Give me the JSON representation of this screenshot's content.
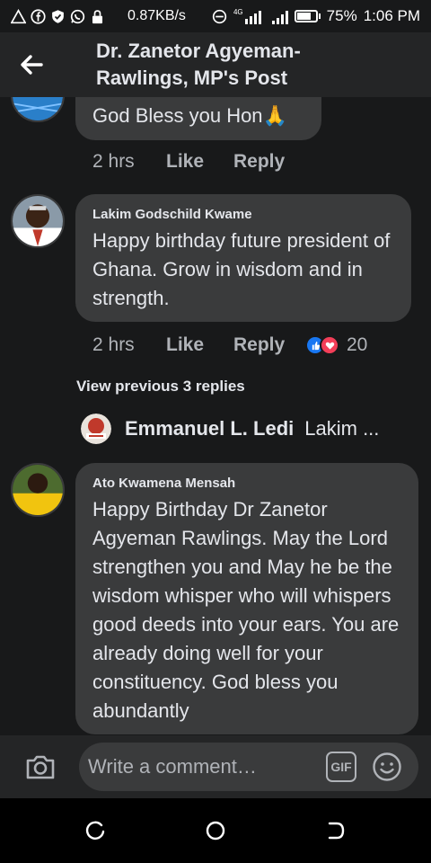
{
  "status_bar": {
    "speed": "0.87KB/s",
    "network": "4G",
    "battery": "75%",
    "time": "1:06 PM",
    "icons": [
      "alert-icon",
      "facebook-icon",
      "shield-icon",
      "whatsapp-icon",
      "lock-icon",
      "no-disturb-icon",
      "signal-icon",
      "battery-icon"
    ]
  },
  "header": {
    "back_icon": "arrow-left-icon",
    "title_line1": "Dr. Zanetor Agyeman-",
    "title_line2": "Rawlings, MP's Post"
  },
  "comments": [
    {
      "text": "God Bless you Hon",
      "emoji": "🙏",
      "time": "2 hrs",
      "like": "Like",
      "reply": "Reply"
    },
    {
      "author": "Lakim Godschild Kwame",
      "text": "Happy birthday future president of Ghana. Grow in wisdom and in strength.",
      "time": "2 hrs",
      "like": "Like",
      "reply": "Reply",
      "reaction_count": "20",
      "reactions": [
        "like-reaction-icon",
        "love-reaction-icon"
      ]
    },
    {
      "author": "Ato Kwamena Mensah",
      "text": "Happy Birthday Dr Zanetor Agyeman Rawlings. May the Lord strengthen you and May he be the wisdom whisper  who will whispers good deeds into your ears. You are already doing well for your constituency. God bless you abundantly"
    }
  ],
  "view_previous": "View previous 3 replies",
  "reply_preview": {
    "name": "Emmanuel L. Ledi",
    "text": "Lakim ..."
  },
  "composer": {
    "placeholder": "Write a comment…",
    "gif_label": "GIF",
    "camera_icon": "camera-icon",
    "emoji_icon": "smiley-icon"
  },
  "navbar": {
    "icons": [
      "recents-icon",
      "home-icon",
      "back-icon"
    ]
  },
  "colors": {
    "background": "#18191a",
    "header": "#242526",
    "bubble": "#3a3b3c",
    "secondary_text": "#b0b3b8",
    "like_blue": "#1877f2",
    "love_red": "#f33e58"
  }
}
